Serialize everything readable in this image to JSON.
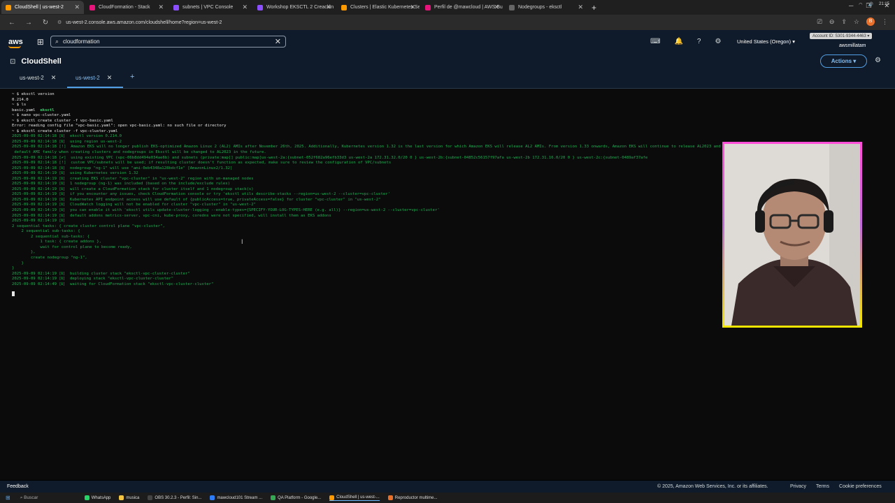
{
  "browser": {
    "tabs": [
      {
        "title": "CloudShell | us-west-2",
        "color": "#ff9900",
        "active": true
      },
      {
        "title": "CloudFormation - Stack",
        "color": "#e7157b",
        "active": false
      },
      {
        "title": "subnets | VPC Console",
        "color": "#8c4fff",
        "active": false
      },
      {
        "title": "Workshop EKSCTL 2 Creación",
        "color": "#8c4fff",
        "active": false
      },
      {
        "title": "Clusters | Elastic Kubernetes Se",
        "color": "#ff9900",
        "active": false
      },
      {
        "title": "Perfil de @mawcloud | AWS Bu",
        "color": "#e7157b",
        "active": false
      },
      {
        "title": "Nodegroups - eksctl",
        "color": "#666666",
        "active": false
      }
    ],
    "url": "us-west-2.console.aws.amazon.com/cloudshell/home?region=us-west-2"
  },
  "awsnav": {
    "logo": "aws",
    "search_value": "cloudformation",
    "region": "United States (Oregon) ▾",
    "account": "Account ID: 5301-9344-4463 ▾",
    "user": "awsmillatam"
  },
  "cloudshell": {
    "title": "CloudShell",
    "actions": "Actions ▾",
    "tabs": [
      {
        "label": "us-west-2"
      },
      {
        "label": "us-west-2"
      }
    ]
  },
  "terminal": {
    "lines": [
      "~ $ eksctl version",
      "0.214.0",
      "~ $ ls",
      "basic.yaml  eksctl",
      "~ $ nano vpc-cluster.yaml",
      "~ $ eksctl create cluster -f vpc-basic.yaml",
      "Error: reading config file \"vpc-basic.yaml\": open vpc-basic.yaml: no such file or directory",
      "~ $ eksctl create cluster -f vpc-cluster.yaml",
      "2025-09-09 02:14:18 [ℹ]  eksctl version 0.214.0",
      "2025-09-09 02:14:18 [ℹ]  using region us-west-2",
      "2025-09-09 02:14:18 [!]  Amazon EKS will no longer publish EKS-optimized Amazon Linux 2 (AL2) AMIs after November 26th, 2025. Additionally, Kubernetes version 1.32 is the last version for which Amazon EKS will release AL2 AMIs. From version 1.33 onwards, Amazon EKS will continue to release AL2023 and Bottlerocket based AMIs. The",
      " default AMI family when creating clusters and nodegroups in Eksctl will be changed to AL2023 in the future.",
      "2025-09-09 02:14:18 [✔]  using existing VPC (vpc-06b8dd494e034ae6b) and subnets (private:map[] public:map[us-west-2a:{subnet-052f682a96efb33d3 us-west-2a 172.31.32.0/20 0 } us-west-2b:{subnet-04852c56157f97afa us-west-2b 172.31.16.0/20 0 } us-west-2c:{subnet-0489af37afe",
      "2025-09-09 02:14:18 [!]  custom VPC/subnets will be used; if resulting cluster doesn't function as expected, make sure to review the configuration of VPC/subnets",
      "2025-09-09 02:14:18 [ℹ]  nodegroup \"ng-1\" will use \"ami-0eb4348a128bdcf1e\" [AmazonLinux2/1.32]",
      "2025-09-09 02:14:19 [ℹ]  using Kubernetes version 1.32",
      "2025-09-09 02:14:19 [ℹ]  creating EKS cluster \"vpc-cluster\" in \"us-west-2\" region with un-managed nodes",
      "2025-09-09 02:14:19 [ℹ]  1 nodegroup (ng-1) was included (based on the include/exclude rules)",
      "2025-09-09 02:14:19 [ℹ]  will create a CloudFormation stack for cluster itself and 1 nodegroup stack(s)",
      "2025-09-09 02:14:19 [ℹ]  if you encounter any issues, check CloudFormation console or try 'eksctl utils describe-stacks --region=us-west-2 --cluster=vpc-cluster'",
      "2025-09-09 02:14:19 [ℹ]  Kubernetes API endpoint access will use default of {publicAccess=true, privateAccess=false} for cluster \"vpc-cluster\" in \"us-west-2\"",
      "2025-09-09 02:14:19 [ℹ]  CloudWatch logging will not be enabled for cluster \"vpc-cluster\" in \"us-west-2\"",
      "2025-09-09 02:14:19 [ℹ]  you can enable it with 'eksctl utils update-cluster-logging --enable-types={SPECIFY-YOUR-LOG-TYPES-HERE (e.g. all)} --region=us-west-2 --cluster=vpc-cluster'",
      "2025-09-09 02:14:19 [ℹ]  default addons metrics-server, vpc-cni, kube-proxy, coredns were not specified, will install them as EKS addons",
      "2025-09-09 02:14:19 [ℹ]",
      "2 sequential tasks: { create cluster control plane \"vpc-cluster\",",
      "    2 sequential sub-tasks: {",
      "        2 sequential sub-tasks: {",
      "            1 task: { create addons },",
      "            wait for control plane to become ready,",
      "        },",
      "        create nodegroup \"ng-1\",",
      "    }",
      "}",
      "2025-09-09 02:14:19 [ℹ]  building cluster stack \"eksctl-vpc-cluster-cluster\"",
      "2025-09-09 02:14:19 [ℹ]  deploying stack \"eksctl-vpc-cluster-cluster\"",
      "2025-09-09 02:14:49 [ℹ]  waiting for CloudFormation stack \"eksctl-vpc-cluster-cluster\""
    ]
  },
  "footer": {
    "feedback": "Feedback",
    "copyright": "© 2025, Amazon Web Services, Inc. or its affiliates.",
    "links": [
      "Privacy",
      "Terms",
      "Cookie preferences"
    ]
  },
  "taskbar": {
    "search": "Buscar",
    "apps": [
      {
        "label": "WhatsApp",
        "color": "#25d366"
      },
      {
        "label": "musica",
        "color": "#f4c542"
      },
      {
        "label": "OBS 30.2.3 - Perfil: Sin...",
        "color": "#444444"
      },
      {
        "label": "mawcloud101 Stream ...",
        "color": "#2e7df6"
      },
      {
        "label": "QA Platform - Google...",
        "color": "#34a853"
      },
      {
        "label": "CloudShell | us-west-...",
        "color": "#ff9900",
        "active": true
      },
      {
        "label": "Reproductor multime...",
        "color": "#e8702a"
      }
    ],
    "time": "21:15"
  }
}
